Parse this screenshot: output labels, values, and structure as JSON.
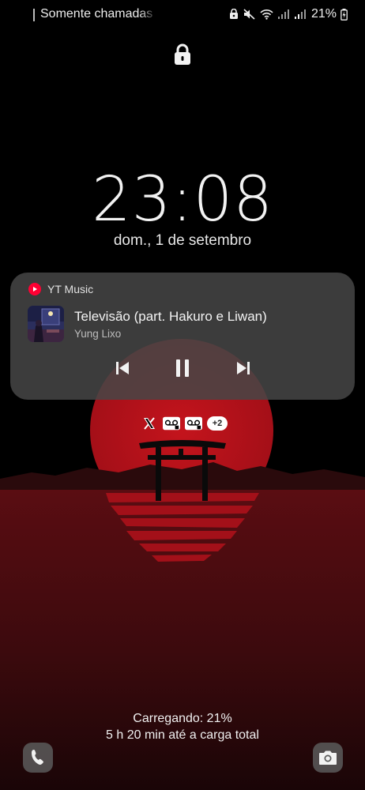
{
  "status_bar": {
    "mode_text": "Somente chamadas",
    "battery_percent": "21%",
    "icons": [
      "lock-screen-notif-icon",
      "mute-icon",
      "wifi-icon",
      "signal-icon",
      "signal-icon",
      "battery-charging-icon"
    ]
  },
  "lock_icon": "padlock-icon",
  "clock": {
    "time": "23:08",
    "date": "dom., 1 de setembro"
  },
  "media": {
    "app_name": "YT Music",
    "title": "Televisão (part. Hakuro e Liwan)",
    "artist": "Yung Lixo",
    "controls": [
      "previous-icon",
      "pause-icon",
      "next-icon"
    ]
  },
  "notifications": {
    "icons": [
      "x-icon",
      "voicemail-icon",
      "voicemail-icon"
    ],
    "more_count": "+2"
  },
  "charging": {
    "line1": "Carregando: 21%",
    "line2": "5 h 20 min até a carga total",
    "level": 0.21
  },
  "shortcuts": {
    "left": "phone-icon",
    "right": "camera-icon"
  },
  "colors": {
    "sun": "#b0121a",
    "sea": "#5a0d12",
    "background": "#000000",
    "youtube_red": "#ff0033"
  }
}
